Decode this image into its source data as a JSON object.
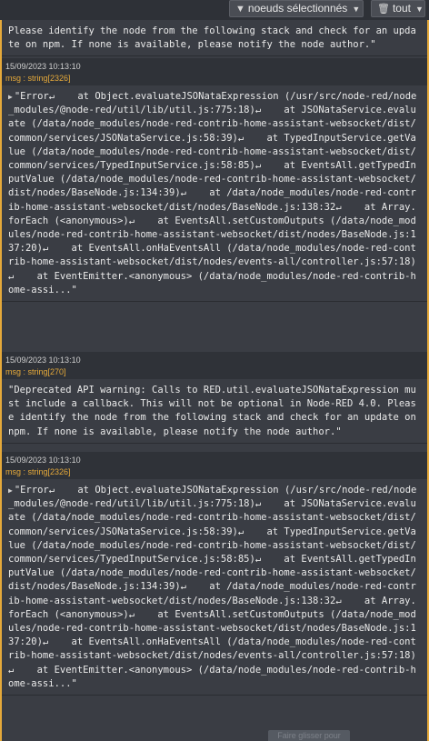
{
  "toolbar": {
    "filter_label": "noeuds sélectionnés",
    "clear_label": "tout",
    "filter_icon": "filter-icon",
    "trash_icon": "trash-icon"
  },
  "messages": [
    {
      "body": "Please identify the node from the following stack and check for an update on npm. If none is available, please notify the node author.\""
    },
    {
      "timestamp": "15/09/2023 10:13:10",
      "source": "msg : string[2326]",
      "body": "\"Error↵    at Object.evaluateJSONataExpression (/usr/src/node-red/node_modules/@node-red/util/lib/util.js:775:18)↵    at JSONataService.evaluate (/data/node_modules/node-red-contrib-home-assistant-websocket/dist/common/services/JSONataService.js:58:39)↵    at TypedInputService.getValue (/data/node_modules/node-red-contrib-home-assistant-websocket/dist/common/services/TypedInputService.js:58:85)↵    at EventsAll.getTypedInputValue (/data/node_modules/node-red-contrib-home-assistant-websocket/dist/nodes/BaseNode.js:134:39)↵    at /data/node_modules/node-red-contrib-home-assistant-websocket/dist/nodes/BaseNode.js:138:32↵    at Array.forEach (<anonymous>)↵    at EventsAll.setCustomOutputs (/data/node_modules/node-red-contrib-home-assistant-websocket/dist/nodes/BaseNode.js:137:20)↵    at EventsAll.onHaEventsAll (/data/node_modules/node-red-contrib-home-assistant-websocket/dist/nodes/events-all/controller.js:57:18)↵    at EventEmitter.<anonymous> (/data/node_modules/node-red-contrib-home-assi...\""
    },
    {
      "timestamp": "15/09/2023 10:13:10",
      "source": "msg : string[270]",
      "body": "\"Deprecated API warning: Calls to RED.util.evaluateJSONataExpression must include a callback. This will not be optional in Node-RED 4.0. Please identify the node from the following stack and check for an update on npm. If none is available, please notify the node author.\""
    },
    {
      "timestamp": "15/09/2023 10:13:10",
      "source": "msg : string[2326]",
      "body": "\"Error↵    at Object.evaluateJSONataExpression (/usr/src/node-red/node_modules/@node-red/util/lib/util.js:775:18)↵    at JSONataService.evaluate (/data/node_modules/node-red-contrib-home-assistant-websocket/dist/common/services/JSONataService.js:58:39)↵    at TypedInputService.getValue (/data/node_modules/node-red-contrib-home-assistant-websocket/dist/common/services/TypedInputService.js:58:85)↵    at EventsAll.getTypedInputValue (/data/node_modules/node-red-contrib-home-assistant-websocket/dist/nodes/BaseNode.js:134:39)↵    at /data/node_modules/node-red-contrib-home-assistant-websocket/dist/nodes/BaseNode.js:138:32↵    at Array.forEach (<anonymous>)↵    at EventsAll.setCustomOutputs (/data/node_modules/node-red-contrib-home-assistant-websocket/dist/nodes/BaseNode.js:137:20)↵    at EventsAll.onHaEventsAll (/data/node_modules/node-red-contrib-home-assistant-websocket/dist/nodes/events-all/controller.js:57:18)↵    at EventEmitter.<anonymous> (/data/node_modules/node-red-contrib-home-assi...\""
    }
  ],
  "drag_hint": "Faire glisser pour"
}
